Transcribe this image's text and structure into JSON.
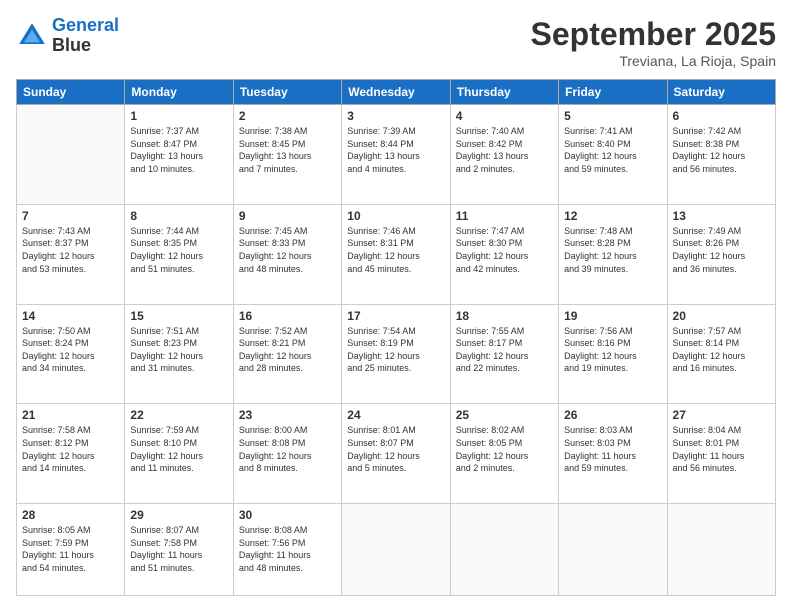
{
  "header": {
    "logo_line1": "General",
    "logo_line2": "Blue",
    "month_title": "September 2025",
    "location": "Treviana, La Rioja, Spain"
  },
  "weekdays": [
    "Sunday",
    "Monday",
    "Tuesday",
    "Wednesday",
    "Thursday",
    "Friday",
    "Saturday"
  ],
  "weeks": [
    [
      {
        "day": "",
        "info": ""
      },
      {
        "day": "1",
        "info": "Sunrise: 7:37 AM\nSunset: 8:47 PM\nDaylight: 13 hours\nand 10 minutes."
      },
      {
        "day": "2",
        "info": "Sunrise: 7:38 AM\nSunset: 8:45 PM\nDaylight: 13 hours\nand 7 minutes."
      },
      {
        "day": "3",
        "info": "Sunrise: 7:39 AM\nSunset: 8:44 PM\nDaylight: 13 hours\nand 4 minutes."
      },
      {
        "day": "4",
        "info": "Sunrise: 7:40 AM\nSunset: 8:42 PM\nDaylight: 13 hours\nand 2 minutes."
      },
      {
        "day": "5",
        "info": "Sunrise: 7:41 AM\nSunset: 8:40 PM\nDaylight: 12 hours\nand 59 minutes."
      },
      {
        "day": "6",
        "info": "Sunrise: 7:42 AM\nSunset: 8:38 PM\nDaylight: 12 hours\nand 56 minutes."
      }
    ],
    [
      {
        "day": "7",
        "info": "Sunrise: 7:43 AM\nSunset: 8:37 PM\nDaylight: 12 hours\nand 53 minutes."
      },
      {
        "day": "8",
        "info": "Sunrise: 7:44 AM\nSunset: 8:35 PM\nDaylight: 12 hours\nand 51 minutes."
      },
      {
        "day": "9",
        "info": "Sunrise: 7:45 AM\nSunset: 8:33 PM\nDaylight: 12 hours\nand 48 minutes."
      },
      {
        "day": "10",
        "info": "Sunrise: 7:46 AM\nSunset: 8:31 PM\nDaylight: 12 hours\nand 45 minutes."
      },
      {
        "day": "11",
        "info": "Sunrise: 7:47 AM\nSunset: 8:30 PM\nDaylight: 12 hours\nand 42 minutes."
      },
      {
        "day": "12",
        "info": "Sunrise: 7:48 AM\nSunset: 8:28 PM\nDaylight: 12 hours\nand 39 minutes."
      },
      {
        "day": "13",
        "info": "Sunrise: 7:49 AM\nSunset: 8:26 PM\nDaylight: 12 hours\nand 36 minutes."
      }
    ],
    [
      {
        "day": "14",
        "info": "Sunrise: 7:50 AM\nSunset: 8:24 PM\nDaylight: 12 hours\nand 34 minutes."
      },
      {
        "day": "15",
        "info": "Sunrise: 7:51 AM\nSunset: 8:23 PM\nDaylight: 12 hours\nand 31 minutes."
      },
      {
        "day": "16",
        "info": "Sunrise: 7:52 AM\nSunset: 8:21 PM\nDaylight: 12 hours\nand 28 minutes."
      },
      {
        "day": "17",
        "info": "Sunrise: 7:54 AM\nSunset: 8:19 PM\nDaylight: 12 hours\nand 25 minutes."
      },
      {
        "day": "18",
        "info": "Sunrise: 7:55 AM\nSunset: 8:17 PM\nDaylight: 12 hours\nand 22 minutes."
      },
      {
        "day": "19",
        "info": "Sunrise: 7:56 AM\nSunset: 8:16 PM\nDaylight: 12 hours\nand 19 minutes."
      },
      {
        "day": "20",
        "info": "Sunrise: 7:57 AM\nSunset: 8:14 PM\nDaylight: 12 hours\nand 16 minutes."
      }
    ],
    [
      {
        "day": "21",
        "info": "Sunrise: 7:58 AM\nSunset: 8:12 PM\nDaylight: 12 hours\nand 14 minutes."
      },
      {
        "day": "22",
        "info": "Sunrise: 7:59 AM\nSunset: 8:10 PM\nDaylight: 12 hours\nand 11 minutes."
      },
      {
        "day": "23",
        "info": "Sunrise: 8:00 AM\nSunset: 8:08 PM\nDaylight: 12 hours\nand 8 minutes."
      },
      {
        "day": "24",
        "info": "Sunrise: 8:01 AM\nSunset: 8:07 PM\nDaylight: 12 hours\nand 5 minutes."
      },
      {
        "day": "25",
        "info": "Sunrise: 8:02 AM\nSunset: 8:05 PM\nDaylight: 12 hours\nand 2 minutes."
      },
      {
        "day": "26",
        "info": "Sunrise: 8:03 AM\nSunset: 8:03 PM\nDaylight: 11 hours\nand 59 minutes."
      },
      {
        "day": "27",
        "info": "Sunrise: 8:04 AM\nSunset: 8:01 PM\nDaylight: 11 hours\nand 56 minutes."
      }
    ],
    [
      {
        "day": "28",
        "info": "Sunrise: 8:05 AM\nSunset: 7:59 PM\nDaylight: 11 hours\nand 54 minutes."
      },
      {
        "day": "29",
        "info": "Sunrise: 8:07 AM\nSunset: 7:58 PM\nDaylight: 11 hours\nand 51 minutes."
      },
      {
        "day": "30",
        "info": "Sunrise: 8:08 AM\nSunset: 7:56 PM\nDaylight: 11 hours\nand 48 minutes."
      },
      {
        "day": "",
        "info": ""
      },
      {
        "day": "",
        "info": ""
      },
      {
        "day": "",
        "info": ""
      },
      {
        "day": "",
        "info": ""
      }
    ]
  ]
}
